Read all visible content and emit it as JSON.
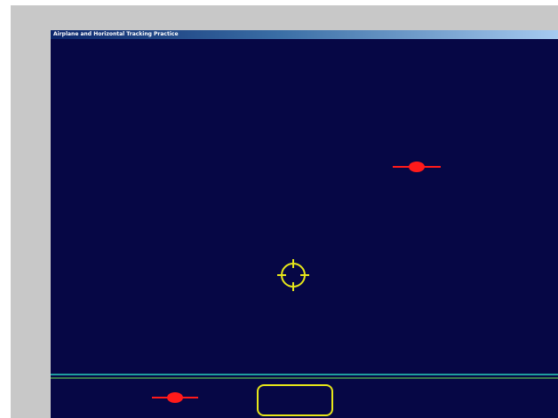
{
  "window": {
    "title": "Airplane and Horizontal Tracking Practice"
  },
  "colors": {
    "frame": "#c8c8c8",
    "background": "#060745",
    "airplane": "#ff1a1a",
    "reticle": "#e6e619",
    "box": "#e6e619",
    "divider_teal": "#1f9e9e",
    "divider_green": "#4ca04c"
  },
  "icons": {
    "target": "airplane-icon",
    "cursor": "crosshair-reticle-icon",
    "horizontal_tracker": "airplane-icon",
    "tracking_zone": "rounded-rectangle"
  }
}
